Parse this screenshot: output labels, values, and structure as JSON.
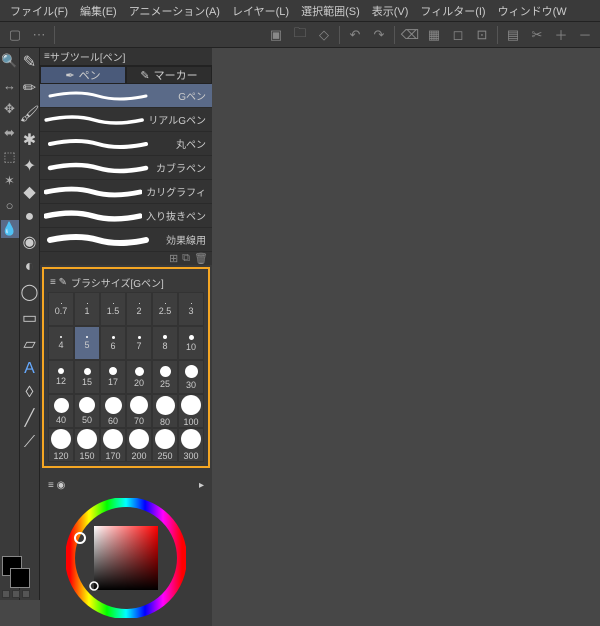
{
  "menu": [
    "ファイル(F)",
    "編集(E)",
    "アニメーション(A)",
    "レイヤー(L)",
    "選択範囲(S)",
    "表示(V)",
    "フィルター(I)",
    "ウィンドウ(W"
  ],
  "subtool_header": "サブツール[ペン]",
  "tabs": {
    "pen": "ペン",
    "marker": "マーカー"
  },
  "pens": [
    {
      "name": "Gペン",
      "sel": true
    },
    {
      "name": "リアルGペン"
    },
    {
      "name": "丸ペン"
    },
    {
      "name": "カブラペン"
    },
    {
      "name": "カリグラフィ"
    },
    {
      "name": "入り抜きペン"
    },
    {
      "name": "効果線用"
    }
  ],
  "brush_header": "ブラシサイズ[Gペン]",
  "brush_sizes": [
    {
      "v": "0.7",
      "d": 1
    },
    {
      "v": "1",
      "d": 1
    },
    {
      "v": "1.5",
      "d": 1
    },
    {
      "v": "2",
      "d": 1
    },
    {
      "v": "2.5",
      "d": 1
    },
    {
      "v": "3",
      "d": 1
    },
    {
      "v": "4",
      "d": 2
    },
    {
      "v": "5",
      "d": 2,
      "sel": true
    },
    {
      "v": "6",
      "d": 3
    },
    {
      "v": "7",
      "d": 3
    },
    {
      "v": "8",
      "d": 4
    },
    {
      "v": "10",
      "d": 5
    },
    {
      "v": "12",
      "d": 6
    },
    {
      "v": "15",
      "d": 7
    },
    {
      "v": "17",
      "d": 8
    },
    {
      "v": "20",
      "d": 9
    },
    {
      "v": "25",
      "d": 11
    },
    {
      "v": "30",
      "d": 13
    },
    {
      "v": "40",
      "d": 15
    },
    {
      "v": "50",
      "d": 16
    },
    {
      "v": "60",
      "d": 17
    },
    {
      "v": "70",
      "d": 18
    },
    {
      "v": "80",
      "d": 19
    },
    {
      "v": "100",
      "d": 20
    },
    {
      "v": "120",
      "d": 20
    },
    {
      "v": "150",
      "d": 20
    },
    {
      "v": "170",
      "d": 20
    },
    {
      "v": "200",
      "d": 20
    },
    {
      "v": "250",
      "d": 20
    },
    {
      "v": "300",
      "d": 20
    }
  ]
}
